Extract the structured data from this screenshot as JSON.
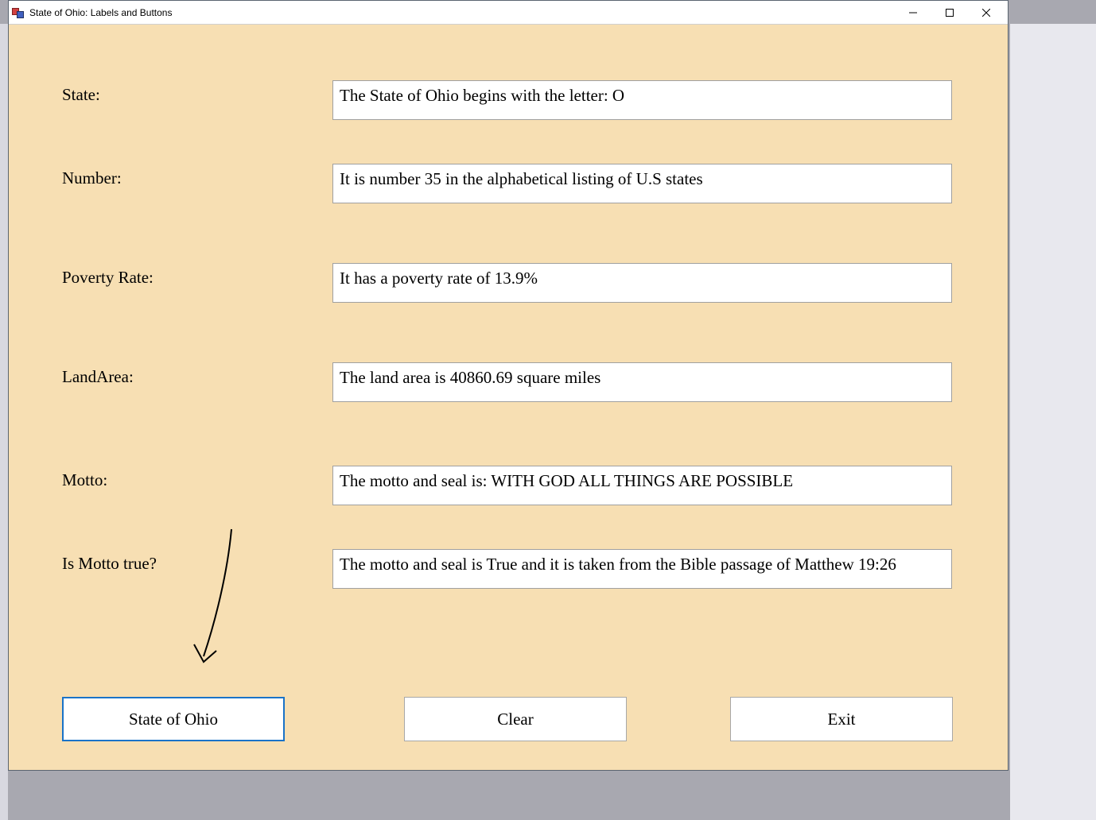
{
  "window": {
    "title": "State of Ohio: Labels and Buttons"
  },
  "labels": {
    "state": "State:",
    "number": "Number:",
    "poverty": "Poverty Rate:",
    "landarea": "LandArea:",
    "motto": "Motto:",
    "mottotrue": "Is Motto true?"
  },
  "values": {
    "state": "The State of Ohio begins with the letter: O",
    "number": "It is number 35 in the alphabetical listing of U.S states",
    "poverty": "It has a poverty rate of 13.9%",
    "landarea": "The land area is 40860.69 square miles",
    "motto": "The motto and seal is: WITH GOD ALL THINGS ARE POSSIBLE",
    "mottotrue": "The motto and seal is True and it is taken from the Bible passage of Matthew 19:26"
  },
  "buttons": {
    "stateofohio": "State of Ohio",
    "clear": "Clear",
    "exit": "Exit"
  }
}
